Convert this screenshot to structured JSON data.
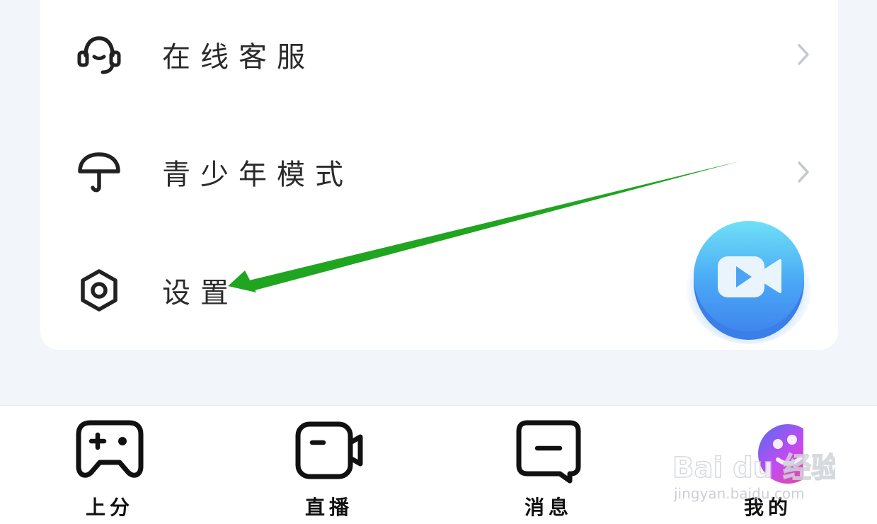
{
  "menu": {
    "items": [
      {
        "label": "在线客服",
        "icon": "headset-icon"
      },
      {
        "label": "青少年模式",
        "icon": "umbrella-icon"
      },
      {
        "label": "设置",
        "icon": "hexagon-settings-icon"
      }
    ]
  },
  "fab": {
    "icon": "video-camera-icon",
    "color": "#4aa8f5"
  },
  "annotation": {
    "color": "#1fa51f"
  },
  "tabbar": {
    "tabs": [
      {
        "label": "上分",
        "icon": "gamepad-icon"
      },
      {
        "label": "直播",
        "icon": "camera-icon"
      },
      {
        "label": "消息",
        "icon": "message-icon"
      },
      {
        "label": "我的",
        "icon": "profile-avatar-icon"
      }
    ]
  },
  "watermark": {
    "text": "Bai du 经验",
    "subtext": "jingyan.baidu.com"
  }
}
